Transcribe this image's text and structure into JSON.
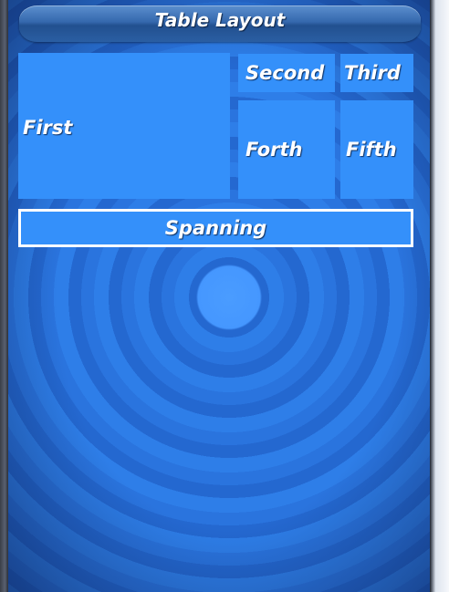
{
  "header": {
    "title": "Table Layout"
  },
  "table": {
    "cells": {
      "first": "First",
      "second": "Second",
      "third": "Third",
      "forth": "Forth",
      "fifth": "Fifth",
      "spanning": "Spanning"
    }
  },
  "colors": {
    "cell": "#3490fa",
    "background": "#2a74de",
    "title_bar": "#3568ad",
    "text": "#ffffff",
    "spanning_border": "#ffffff"
  }
}
